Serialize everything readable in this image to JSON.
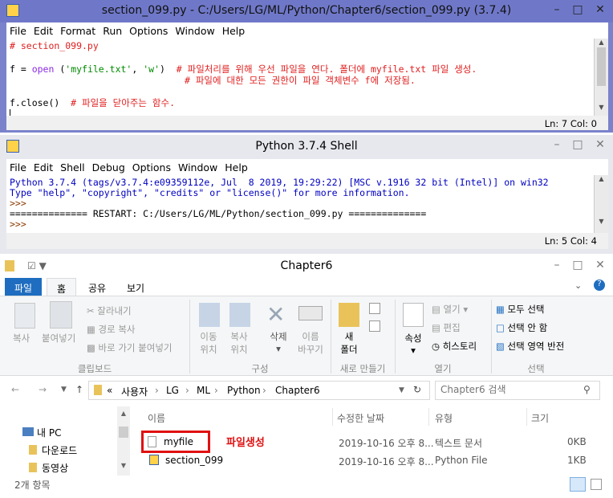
{
  "editor": {
    "title": "section_099.py - C:/Users/LG/ML/Python/Chapter6/section_099.py (3.7.4)",
    "menu": [
      "File",
      "Edit",
      "Format",
      "Run",
      "Options",
      "Window",
      "Help"
    ],
    "line1": "# section_099.py",
    "l3_a": "f = ",
    "l3_open": "open",
    "l3_b": " (",
    "l3_s1": "'myfile.txt'",
    "l3_c": ", ",
    "l3_s2": "'w'",
    "l3_d": ")  ",
    "l3_comment": "# 파일처리를 위해 우선 파일을 연다. 폴더에 myfile.txt 파일 생성.",
    "l4_comment": "# 파일에 대한 모든 권한이 파일 객체변수 f에 저장됨.",
    "l6_a": "f.close()  ",
    "l6_comment": "# 파일을 닫아주는 함수.",
    "status": "Ln: 7  Col: 0"
  },
  "shell": {
    "title": "Python 3.7.4 Shell",
    "menu": [
      "File",
      "Edit",
      "Shell",
      "Debug",
      "Options",
      "Window",
      "Help"
    ],
    "lines": [
      "Python 3.7.4 (tags/v3.7.4:e09359112e, Jul  8 2019, 19:29:22) [MSC v.1916 32 bit (Intel)] on win32",
      "Type \"help\", \"copyright\", \"credits\" or \"license()\" for more information.",
      ">>> ",
      "============== RESTART: C:/Users/LG/ML/Python/section_099.py =============="
    ],
    "prompt": ">>> ",
    "status": "Ln: 5  Col: 4"
  },
  "explorer": {
    "title": "Chapter6",
    "tabs": [
      "파일",
      "홈",
      "공유",
      "보기"
    ],
    "clip": {
      "copy": "복사",
      "paste": "붙여넣기",
      "cut": "잘라내기",
      "copypath": "경로 복사",
      "shortcut": "바로 가기 붙여넣기",
      "group": "클립보드"
    },
    "org": {
      "move1": "이동",
      "move2": "위치",
      "copy1": "복사",
      "copy2": "위치",
      "del": "삭제",
      "ren1": "이름",
      "ren2": "바꾸기",
      "group": "구성"
    },
    "new": {
      "f1": "새",
      "f2": "폴더",
      "group": "새로 만들기"
    },
    "open": {
      "prop": "속성",
      "open": "열기",
      "edit": "편집",
      "hist": "히스토리",
      "group": "열기"
    },
    "sel": {
      "all": "모두 선택",
      "none": "선택 안 함",
      "inv": "선택 영역 반전",
      "group": "선택"
    },
    "crumbs": [
      "«",
      "사용자",
      "LG",
      "ML",
      "Python",
      "Chapter6"
    ],
    "search_placeholder": "Chapter6 검색",
    "side": [
      "내 PC",
      "다운로드",
      "동영상"
    ],
    "cols": [
      "이름",
      "수정한 날짜",
      "유형",
      "크기"
    ],
    "files": [
      {
        "name": "myfile",
        "date": "2019-10-16 오후 8...",
        "type": "텍스트 문서",
        "size": "0KB"
      },
      {
        "name": "section_099",
        "date": "2019-10-16 오후 8...",
        "type": "Python File",
        "size": "1KB"
      }
    ],
    "annotation": "파일생성",
    "count": "2개 항목"
  }
}
